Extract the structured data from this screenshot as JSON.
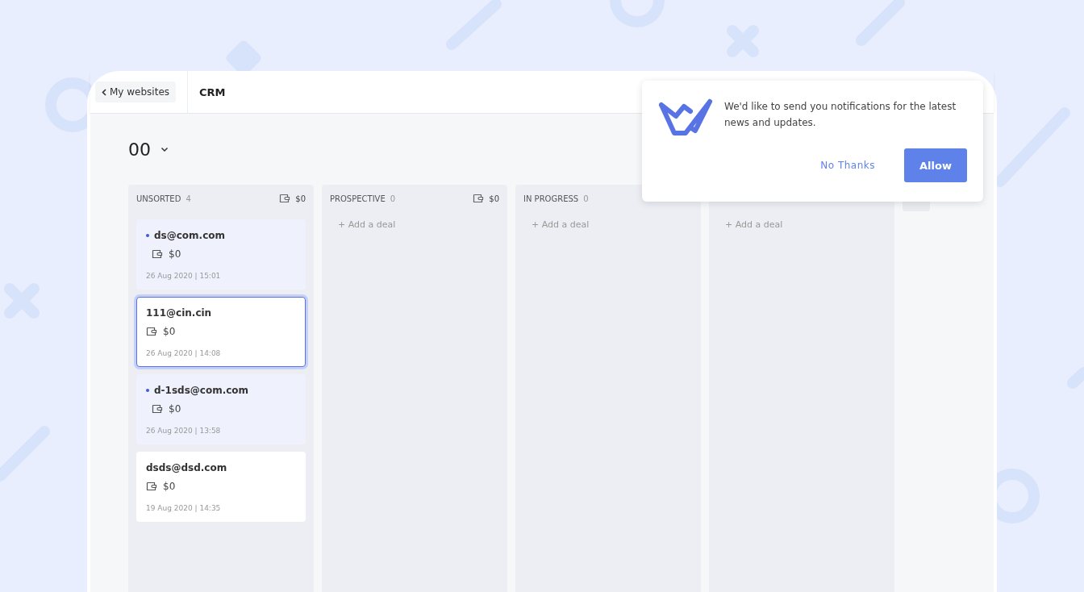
{
  "header": {
    "back_label": "My websites",
    "title": "CRM"
  },
  "pipeline": {
    "name": "00"
  },
  "columns": [
    {
      "title": "UNSORTED",
      "count": "4",
      "amount": "$0",
      "cards": [
        {
          "email": "ds@com.com",
          "amount": "$0",
          "date": "26 Aug 2020 | 15:01",
          "unread": true,
          "selected": false
        },
        {
          "email": "111@cin.cin",
          "amount": "$0",
          "date": "26 Aug 2020 | 14:08",
          "unread": false,
          "selected": true
        },
        {
          "email": "d-1sds@com.com",
          "amount": "$0",
          "date": "26 Aug 2020 | 13:58",
          "unread": true,
          "selected": false
        },
        {
          "email": "dsds@dsd.com",
          "amount": "$0",
          "date": "19 Aug 2020 | 14:35",
          "unread": false,
          "selected": false
        }
      ]
    },
    {
      "title": "PROSPECTIVE",
      "count": "0",
      "amount": "$0",
      "add_label": "+ Add a deal"
    },
    {
      "title": "IN PROGRESS",
      "count": "0",
      "add_label": "+ Add a deal"
    },
    {
      "add_label": "+ Add a deal"
    }
  ],
  "notification": {
    "message": "We'd like to send you notifications for the latest news and updates.",
    "decline": "No Thanks",
    "accept": "Allow"
  }
}
